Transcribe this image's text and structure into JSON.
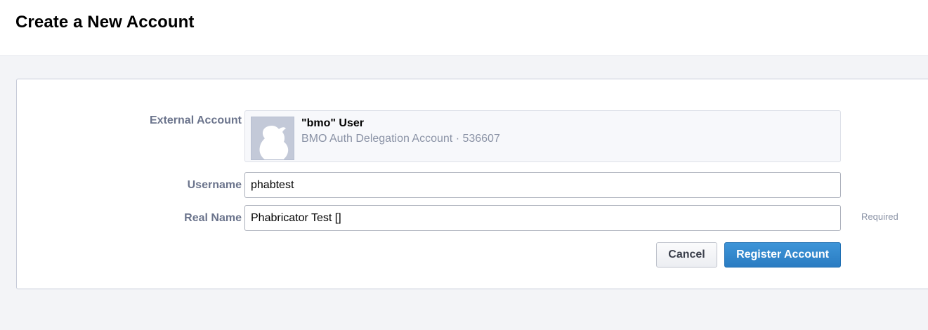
{
  "page": {
    "title": "Create a New Account"
  },
  "form": {
    "external_account": {
      "label": "External Account",
      "name": "\"bmo\" User",
      "description": "BMO Auth Delegation Account · 536607",
      "avatar_icon": "duck-silhouette-icon"
    },
    "username": {
      "label": "Username",
      "value": "phabtest"
    },
    "real_name": {
      "label": "Real Name",
      "value": "Phabricator Test []",
      "caption": "Required"
    },
    "buttons": {
      "cancel_label": "Cancel",
      "register_label": "Register Account"
    }
  },
  "colors": {
    "page_background": "#f3f4f7",
    "label_text": "#6b748c",
    "primary_button": "#2a7cc2",
    "muted_text": "#8b93a6"
  }
}
